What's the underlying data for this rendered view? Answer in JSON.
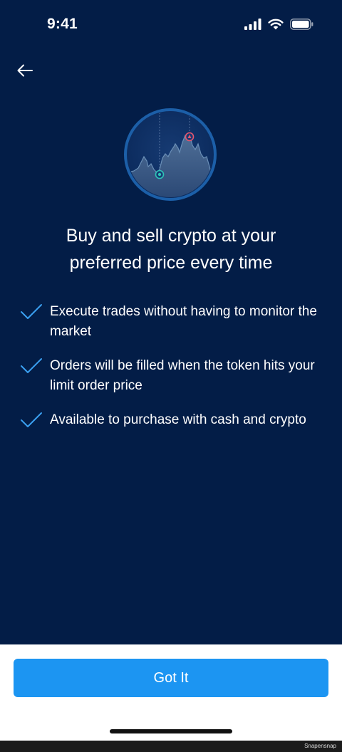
{
  "status_bar": {
    "time": "9:41",
    "icons": [
      "cellular-signal-icon",
      "wifi-icon",
      "battery-icon"
    ]
  },
  "navigation": {
    "back_icon": "arrow-left-icon"
  },
  "hero": {
    "icon": "price-chart-illustration",
    "low_marker_color": "#2ec4b6",
    "high_marker_color": "#e8556d"
  },
  "headline": "Buy and sell crypto at your preferred price every time",
  "features": [
    {
      "icon": "checkmark-icon",
      "text": "Execute trades without having to monitor the market"
    },
    {
      "icon": "checkmark-icon",
      "text": "Orders will be filled when the token hits your limit order price"
    },
    {
      "icon": "checkmark-icon",
      "text": "Available to purchase with cash and crypto"
    }
  ],
  "cta": {
    "label": "Got It"
  },
  "watermark": "Snapensnap",
  "colors": {
    "background": "#031d47",
    "accent": "#1c95f2",
    "check": "#3a9ff0"
  }
}
